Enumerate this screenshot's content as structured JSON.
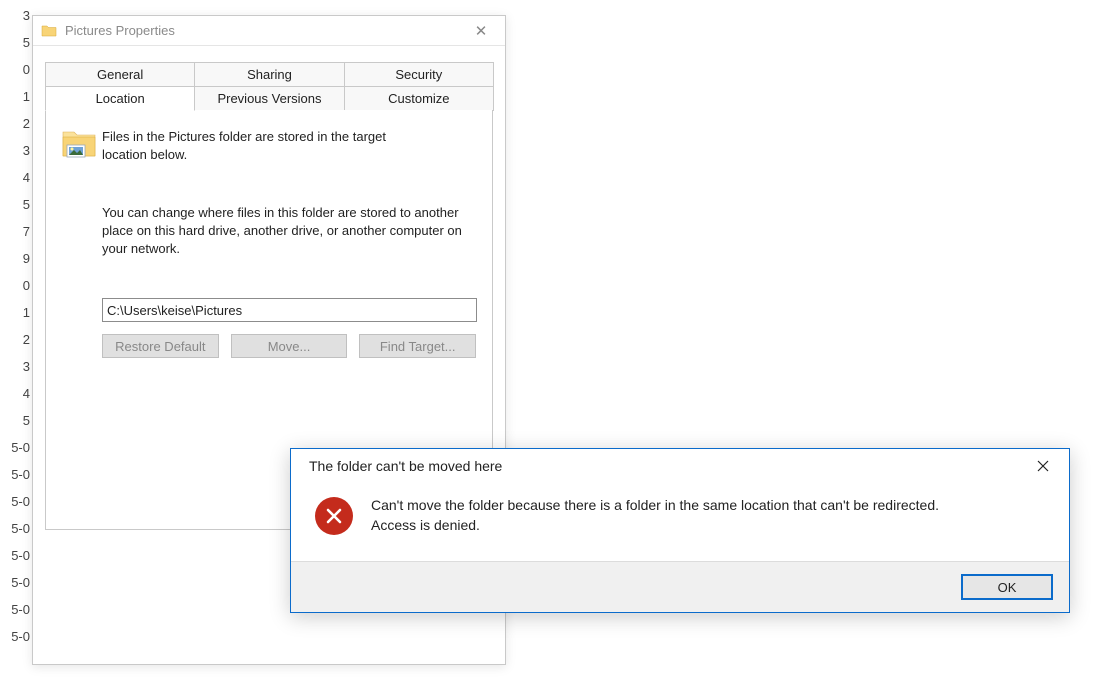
{
  "background": {
    "side_numbers": [
      "3",
      "5",
      "",
      "0",
      "1",
      "2",
      "3",
      "4",
      "5",
      "7",
      "9",
      "0",
      "1",
      "2",
      "3",
      "4",
      "5",
      "5-0",
      "5-0",
      "5-0",
      "5-0",
      "5-0",
      "5-0",
      "5-0",
      "5-0"
    ]
  },
  "properties_window": {
    "title": "Pictures Properties",
    "close_glyph": "✕",
    "tabs_row1": [
      "General",
      "Sharing",
      "Security"
    ],
    "tabs_row2": [
      "Location",
      "Previous Versions",
      "Customize"
    ],
    "active_tab": "Location",
    "desc1": "Files in the Pictures folder are stored in the target location below.",
    "desc2": "You can change where files in this folder are stored to another place on this hard drive, another drive, or another computer on your network.",
    "path_value": "C:\\Users\\keise\\Pictures",
    "buttons": {
      "restore": "Restore Default",
      "move": "Move...",
      "find": "Find Target..."
    }
  },
  "error_dialog": {
    "title": "The folder can't be moved here",
    "close_glyph": "✕",
    "message_line1": "Can't move the folder because there is a folder in the same location that can't be redirected.",
    "message_line2": "Access is denied.",
    "ok_label": "OK"
  }
}
